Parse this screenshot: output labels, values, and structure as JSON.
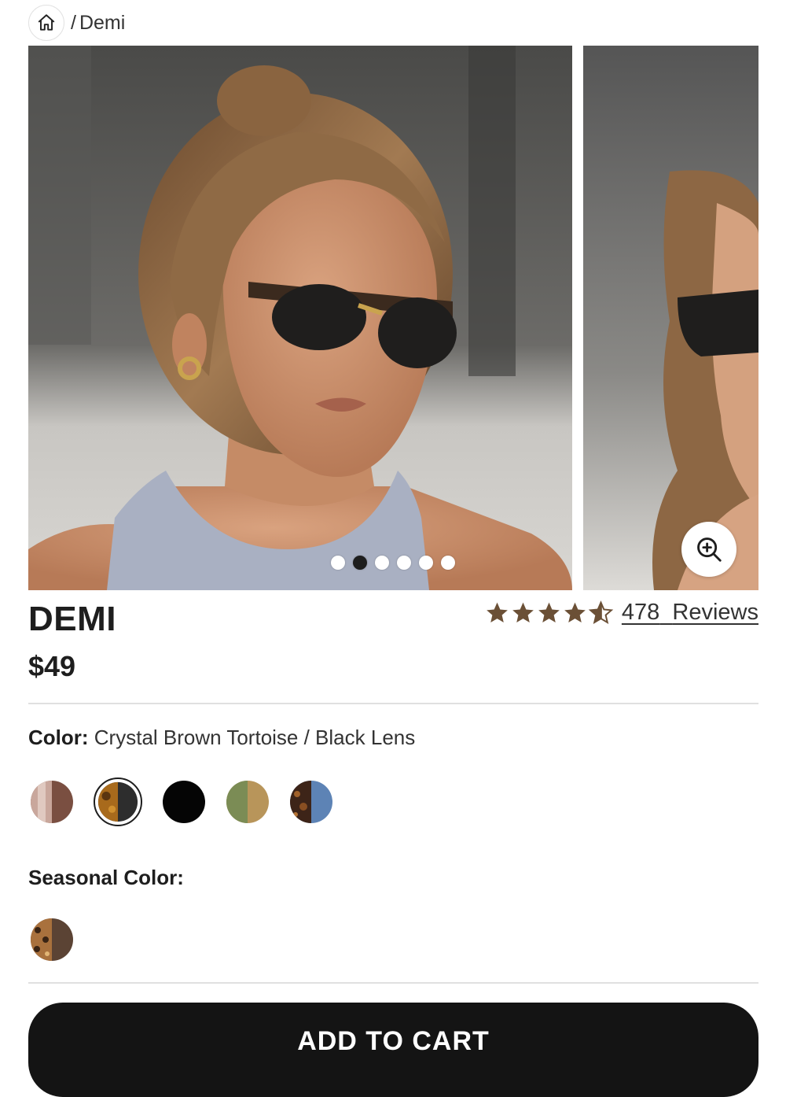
{
  "breadcrumb": {
    "separator": "/",
    "current": "Demi"
  },
  "gallery": {
    "slides_total": 6,
    "active_slide": 2
  },
  "product": {
    "name": "DEMI",
    "price": "$49",
    "rating": {
      "stars": 4.5,
      "count": "478",
      "label": "Reviews"
    }
  },
  "color": {
    "label": "Color:",
    "selected_value": "Crystal Brown Tortoise / Black Lens",
    "swatches": [
      {
        "name": "rose-brown",
        "colors": [
          "#c9a79c",
          "#7a4f41"
        ]
      },
      {
        "name": "crystal-brown-tortoise",
        "colors": [
          "#a86a1c",
          "#2d2d2d"
        ],
        "selected": true
      },
      {
        "name": "black",
        "colors": [
          "#050505",
          "#050505"
        ]
      },
      {
        "name": "olive-gold",
        "colors": [
          "#7b8c55",
          "#b8955a"
        ]
      },
      {
        "name": "tortoise-blue",
        "colors": [
          "#3d2418",
          "#5d83b5"
        ]
      }
    ]
  },
  "seasonal": {
    "label": "Seasonal Color:",
    "swatches": [
      {
        "name": "leopard-brown",
        "colors": [
          "#a9713d",
          "#5b4334"
        ]
      }
    ]
  },
  "cart": {
    "label": "ADD TO CART"
  },
  "colors": {
    "star": "#6b5036",
    "button": "#141414",
    "divider": "#e0e0e0"
  }
}
